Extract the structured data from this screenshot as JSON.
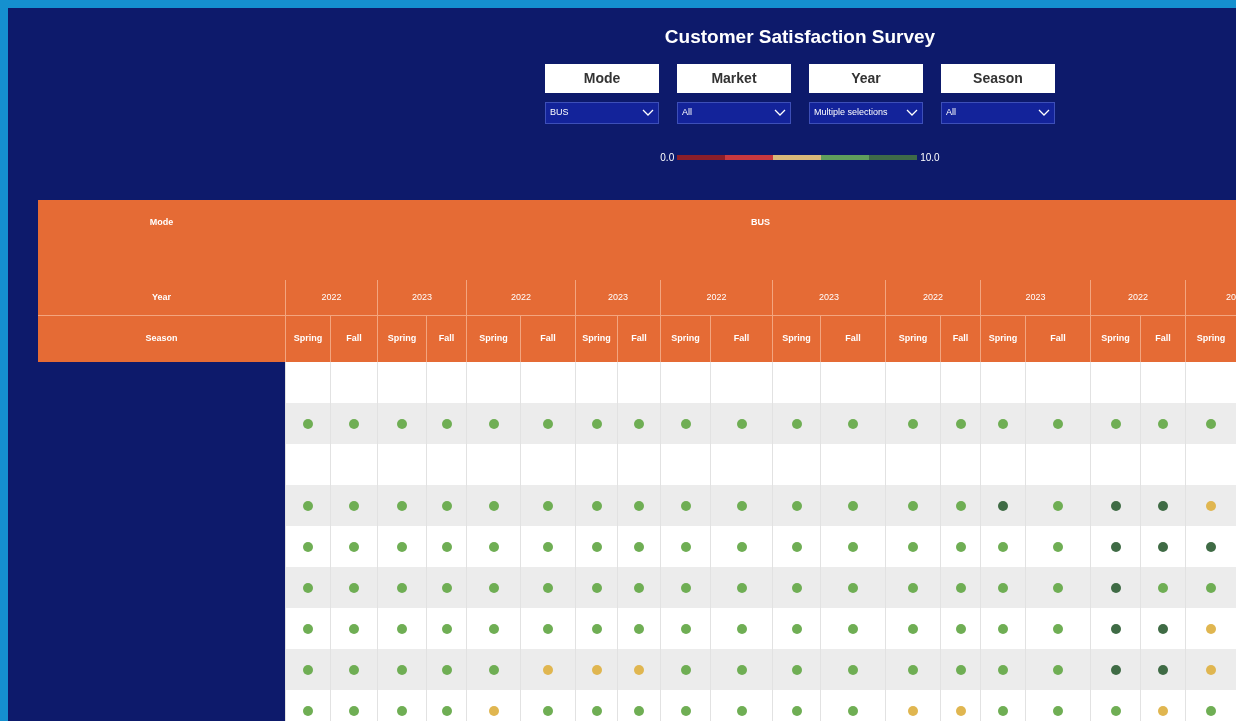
{
  "title": "Customer Satisfaction Survey",
  "filters": [
    {
      "label": "Mode",
      "value": "BUS"
    },
    {
      "label": "Market",
      "value": "All"
    },
    {
      "label": "Year",
      "value": "Multiple selections"
    },
    {
      "label": "Season",
      "value": "All"
    }
  ],
  "legend": {
    "min": "0.0",
    "max": "10.0"
  },
  "table": {
    "row_headers": [
      "Mode",
      "Year",
      "Season"
    ],
    "mode": "BUS",
    "years": [
      "2022",
      "2023",
      "2022",
      "2023",
      "2022",
      "2023",
      "2022",
      "2023",
      "2022",
      "20"
    ],
    "seasons": [
      "Spring",
      "Fall",
      "Spring",
      "Fall",
      "Spring",
      "Fall",
      "Spring",
      "Fall",
      "Spring",
      "Fall",
      "Spring",
      "Fall",
      "Spring",
      "Fall",
      "Spring",
      "Fall",
      "Spring",
      "Fall",
      "Spring"
    ],
    "rows": [
      {
        "kind": "blank"
      },
      {
        "kind": "dots",
        "cells": [
          {
            "color": "#6fae54"
          },
          {
            "color": "#6fae54"
          },
          {
            "color": "#6fae54"
          },
          {
            "color": "#6fae54"
          },
          {
            "color": "#6fae54"
          },
          {
            "color": "#6fae54"
          },
          {
            "color": "#6fae54"
          },
          {
            "color": "#6fae54"
          },
          {
            "color": "#6fae54"
          },
          {
            "color": "#6fae54"
          },
          {
            "color": "#6fae54"
          },
          {
            "color": "#6fae54"
          },
          {
            "color": "#6fae54"
          },
          {
            "color": "#6fae54"
          },
          {
            "color": "#6fae54"
          },
          {
            "color": "#6fae54"
          },
          {
            "color": "#6fae54"
          },
          {
            "color": "#6fae54"
          },
          {
            "color": "#6fae54"
          }
        ]
      },
      {
        "kind": "blank"
      },
      {
        "kind": "dots",
        "cells": [
          {
            "color": "#6fae54"
          },
          {
            "color": "#6fae54"
          },
          {
            "color": "#6fae54"
          },
          {
            "color": "#6fae54"
          },
          {
            "color": "#6fae54"
          },
          {
            "color": "#6fae54"
          },
          {
            "color": "#6fae54"
          },
          {
            "color": "#6fae54"
          },
          {
            "color": "#6fae54"
          },
          {
            "color": "#6fae54"
          },
          {
            "color": "#6fae54"
          },
          {
            "color": "#6fae54"
          },
          {
            "color": "#6fae54"
          },
          {
            "color": "#6fae54"
          },
          {
            "color": "#3f6b45"
          },
          {
            "color": "#6fae54"
          },
          {
            "color": "#3f6b45"
          },
          {
            "color": "#3f6b45"
          },
          {
            "color": "#e0b650"
          }
        ]
      },
      {
        "kind": "dots",
        "cells": [
          {
            "color": "#6fae54"
          },
          {
            "color": "#6fae54"
          },
          {
            "color": "#6fae54"
          },
          {
            "color": "#6fae54"
          },
          {
            "color": "#6fae54"
          },
          {
            "color": "#6fae54"
          },
          {
            "color": "#6fae54"
          },
          {
            "color": "#6fae54"
          },
          {
            "color": "#6fae54"
          },
          {
            "color": "#6fae54"
          },
          {
            "color": "#6fae54"
          },
          {
            "color": "#6fae54"
          },
          {
            "color": "#6fae54"
          },
          {
            "color": "#6fae54"
          },
          {
            "color": "#6fae54"
          },
          {
            "color": "#6fae54"
          },
          {
            "color": "#3f6b45"
          },
          {
            "color": "#3f6b45"
          },
          {
            "color": "#3f6b45"
          }
        ]
      },
      {
        "kind": "dots",
        "cells": [
          {
            "color": "#6fae54"
          },
          {
            "color": "#6fae54"
          },
          {
            "color": "#6fae54"
          },
          {
            "color": "#6fae54"
          },
          {
            "color": "#6fae54"
          },
          {
            "color": "#6fae54"
          },
          {
            "color": "#6fae54"
          },
          {
            "color": "#6fae54"
          },
          {
            "color": "#6fae54"
          },
          {
            "color": "#6fae54"
          },
          {
            "color": "#6fae54"
          },
          {
            "color": "#6fae54"
          },
          {
            "color": "#6fae54"
          },
          {
            "color": "#6fae54"
          },
          {
            "color": "#6fae54"
          },
          {
            "color": "#6fae54"
          },
          {
            "color": "#3f6b45"
          },
          {
            "color": "#6fae54"
          },
          {
            "color": "#6fae54"
          }
        ]
      },
      {
        "kind": "dots",
        "cells": [
          {
            "color": "#6fae54"
          },
          {
            "color": "#6fae54"
          },
          {
            "color": "#6fae54"
          },
          {
            "color": "#6fae54"
          },
          {
            "color": "#6fae54"
          },
          {
            "color": "#6fae54"
          },
          {
            "color": "#6fae54"
          },
          {
            "color": "#6fae54"
          },
          {
            "color": "#6fae54"
          },
          {
            "color": "#6fae54"
          },
          {
            "color": "#6fae54"
          },
          {
            "color": "#6fae54"
          },
          {
            "color": "#6fae54"
          },
          {
            "color": "#6fae54"
          },
          {
            "color": "#6fae54"
          },
          {
            "color": "#6fae54"
          },
          {
            "color": "#3f6b45"
          },
          {
            "color": "#3f6b45"
          },
          {
            "color": "#e0b650"
          }
        ]
      },
      {
        "kind": "dots",
        "cells": [
          {
            "color": "#6fae54"
          },
          {
            "color": "#6fae54"
          },
          {
            "color": "#6fae54"
          },
          {
            "color": "#6fae54"
          },
          {
            "color": "#6fae54"
          },
          {
            "color": "#e0b650"
          },
          {
            "color": "#e0b650"
          },
          {
            "color": "#e0b650"
          },
          {
            "color": "#6fae54"
          },
          {
            "color": "#6fae54"
          },
          {
            "color": "#6fae54"
          },
          {
            "color": "#6fae54"
          },
          {
            "color": "#6fae54"
          },
          {
            "color": "#6fae54"
          },
          {
            "color": "#6fae54"
          },
          {
            "color": "#6fae54"
          },
          {
            "color": "#3f6b45"
          },
          {
            "color": "#3f6b45"
          },
          {
            "color": "#e0b650"
          }
        ]
      },
      {
        "kind": "dots",
        "cells": [
          {
            "color": "#6fae54"
          },
          {
            "color": "#6fae54"
          },
          {
            "color": "#6fae54"
          },
          {
            "color": "#6fae54"
          },
          {
            "color": "#e0b650"
          },
          {
            "color": "#6fae54"
          },
          {
            "color": "#6fae54"
          },
          {
            "color": "#6fae54"
          },
          {
            "color": "#6fae54"
          },
          {
            "color": "#6fae54"
          },
          {
            "color": "#6fae54"
          },
          {
            "color": "#6fae54"
          },
          {
            "color": "#e0b650"
          },
          {
            "color": "#e0b650"
          },
          {
            "color": "#6fae54"
          },
          {
            "color": "#6fae54"
          },
          {
            "color": "#6fae54"
          },
          {
            "color": "#e0b650"
          },
          {
            "color": "#6fae54"
          }
        ]
      }
    ]
  }
}
